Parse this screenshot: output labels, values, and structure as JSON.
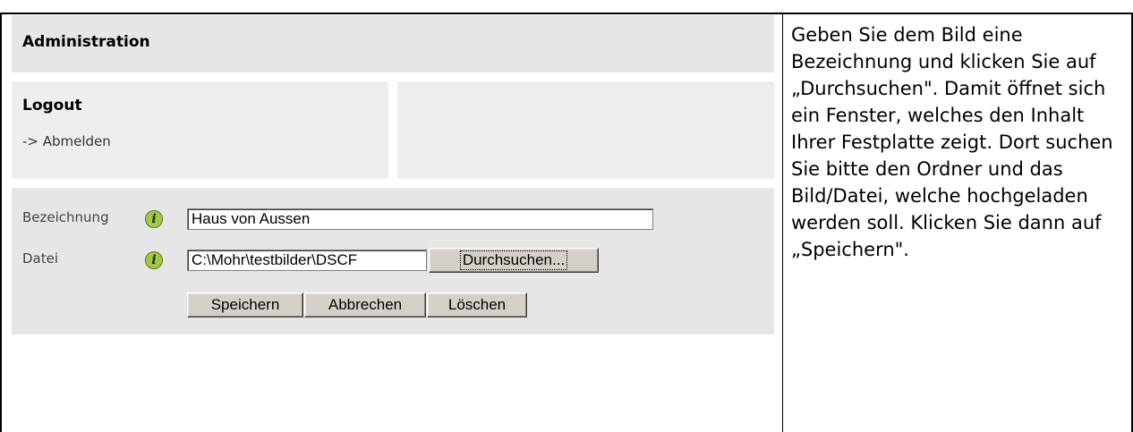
{
  "admin": {
    "header": "Administration",
    "logout_title": "Logout",
    "logout_link": "-> Abmelden"
  },
  "form": {
    "label_name": "Bezeichnung",
    "label_file": "Datei",
    "name_value": "Haus von Aussen",
    "file_value": "C:\\Mohr\\testbilder\\DSCF",
    "browse_label": "Durchsuchen...",
    "save_label": "Speichern",
    "cancel_label": "Abbrechen",
    "delete_label": "Löschen"
  },
  "instructions": {
    "text": "Geben Sie dem Bild eine Bezeichnung und klicken Sie auf „Durchsuchen\". Damit öffnet sich ein Fenster, welches den Inhalt Ihrer Festplatte zeigt. Dort suchen Sie bitte den Ordner und das Bild/Datei, welche hochgeladen werden soll. Klicken Sie dann auf „Speichern\"."
  },
  "icons": {
    "info": "info-icon"
  }
}
